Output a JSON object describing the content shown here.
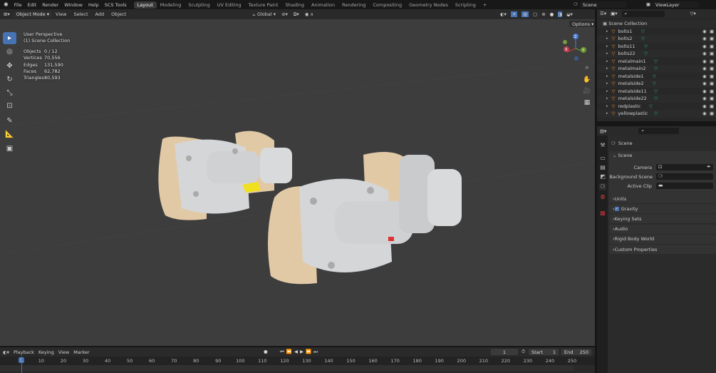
{
  "topbar": {
    "menus": [
      "File",
      "Edit",
      "Render",
      "Window",
      "Help",
      "SCS Tools"
    ],
    "workspaces": [
      "Layout",
      "Modeling",
      "Sculpting",
      "UV Editing",
      "Texture Paint",
      "Shading",
      "Animation",
      "Rendering",
      "Compositing",
      "Geometry Nodes",
      "Scripting"
    ],
    "active_workspace": "Layout",
    "add": "+",
    "scene": "Scene",
    "view_layer": "ViewLayer"
  },
  "viewport_header": {
    "mode": "Object Mode",
    "menus": [
      "View",
      "Select",
      "Add",
      "Object"
    ],
    "orientation": "Global",
    "options": "Options"
  },
  "overlay": {
    "perspective": "User Perspective",
    "collection": "(1) Scene Collection",
    "stats": [
      {
        "k": "Objects",
        "v": "0 / 12"
      },
      {
        "k": "Vertices",
        "v": "70,556"
      },
      {
        "k": "Edges",
        "v": "131,590"
      },
      {
        "k": "Faces",
        "v": "62,782"
      },
      {
        "k": "Triangles",
        "v": "80,593"
      }
    ]
  },
  "gizmo": {
    "x": "X",
    "y": "Y",
    "z": "Z"
  },
  "outliner": {
    "root": "Scene Collection",
    "items": [
      "bolts1",
      "bolts2",
      "bolts11",
      "bolts22",
      "metalmain1",
      "metalmain2",
      "metalside1",
      "metalside2",
      "metalside11",
      "metalside22",
      "redplastic",
      "yellowplastic"
    ]
  },
  "properties": {
    "title": "Scene",
    "section": "Scene",
    "camera_label": "Camera",
    "bg_label": "Background Scene",
    "clip_label": "Active Clip",
    "panels": [
      "Units",
      "Gravity",
      "Keying Sets",
      "Audio",
      "Rigid Body World",
      "Custom Properties"
    ],
    "gravity_checked": true
  },
  "timeline": {
    "menus": [
      "Playback",
      "Keying",
      "View",
      "Marker"
    ],
    "current_frame": "1",
    "start_label": "Start",
    "start": "1",
    "end_label": "End",
    "end": "250",
    "ticks": [
      "1",
      "10",
      "20",
      "30",
      "40",
      "50",
      "60",
      "70",
      "80",
      "90",
      "100",
      "110",
      "120",
      "130",
      "140",
      "150",
      "160",
      "170",
      "180",
      "190",
      "200",
      "210",
      "220",
      "230",
      "240",
      "250"
    ]
  },
  "colors": {
    "accent": "#4772b3",
    "viewport": "#3d3d3d",
    "object_orange": "#e8903a",
    "mesh_green": "#2fa37a"
  }
}
